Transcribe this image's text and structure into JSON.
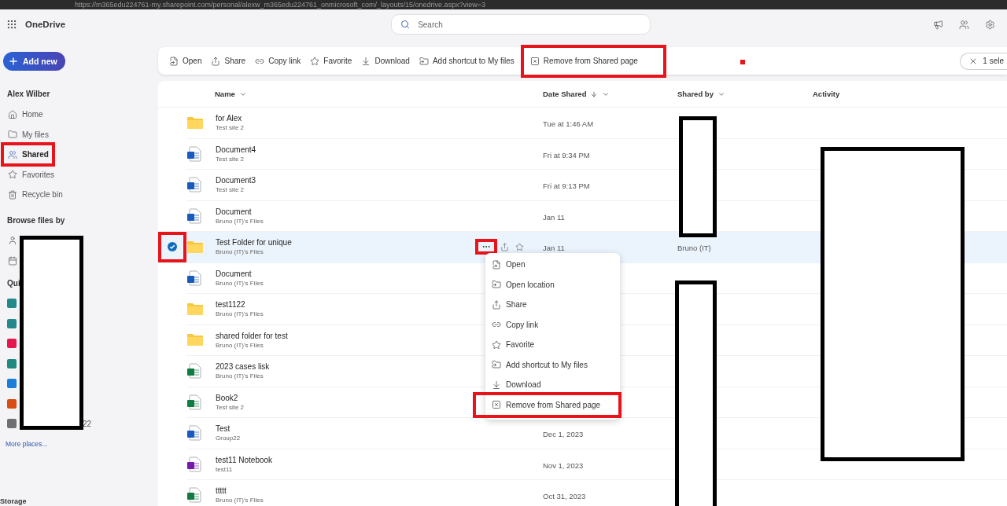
{
  "browser": {
    "address": "https://m365edu224761-my.sharepoint.com/personal/alexw_m365edu224761_onmicrosoft_com/_layouts/15/onedrive.aspx?view=3"
  },
  "app": {
    "title": "OneDrive"
  },
  "search": {
    "placeholder": "Search"
  },
  "sidebar": {
    "add_button": "Add new",
    "user": "Alex Wilber",
    "nav": [
      {
        "label": "Home",
        "kind": "home",
        "selected": false,
        "highlighted": false
      },
      {
        "label": "My files",
        "kind": "folder",
        "selected": false,
        "highlighted": false
      },
      {
        "label": "Shared",
        "kind": "people",
        "selected": true,
        "highlighted": true
      },
      {
        "label": "Favorites",
        "kind": "star",
        "selected": false,
        "highlighted": false
      },
      {
        "label": "Recycle bin",
        "kind": "bin",
        "selected": false,
        "highlighted": false
      }
    ],
    "browse_heading": "Browse files by",
    "quick_heading": "Qui",
    "quick_items": [
      {
        "color": "#23898b"
      },
      {
        "color": "#23898b"
      },
      {
        "color": "#e3194e"
      },
      {
        "color": "#1f8a80"
      },
      {
        "color": "#1a7fd9"
      },
      {
        "color": "#d94c14"
      },
      {
        "color": "#6f6f6f",
        "label": "22"
      }
    ],
    "more_places": "More places...",
    "storage": "Storage"
  },
  "toolbar": {
    "actions": [
      {
        "label": "Open",
        "kind": "open",
        "highlighted": false
      },
      {
        "label": "Share",
        "kind": "share",
        "highlighted": false
      },
      {
        "label": "Copy link",
        "kind": "link",
        "highlighted": false
      },
      {
        "label": "Favorite",
        "kind": "star",
        "highlighted": false
      },
      {
        "label": "Download",
        "kind": "download",
        "highlighted": false
      },
      {
        "label": "Add shortcut to My files",
        "kind": "shortcut",
        "highlighted": false
      },
      {
        "label": "Remove from Shared page",
        "kind": "remove",
        "highlighted": true
      }
    ],
    "selection": "1 sele"
  },
  "table": {
    "columns": [
      {
        "label": "Name",
        "sorted": false,
        "dropdown": true
      },
      {
        "label": "Date Shared",
        "sorted": true,
        "dropdown": true
      },
      {
        "label": "Shared by",
        "sorted": false,
        "dropdown": true
      },
      {
        "label": "Activity",
        "sorted": false,
        "dropdown": false
      }
    ],
    "rows": [
      {
        "name": "for Alex",
        "location": "Test site 2",
        "date": "Tue at 1:46 AM",
        "kind": "folder",
        "selected": false
      },
      {
        "name": "Document4",
        "location": "Test site 2",
        "date": "Fri at 9:34 PM",
        "kind": "word",
        "selected": false
      },
      {
        "name": "Document3",
        "location": "Test site 2",
        "date": "Fri at 9:13 PM",
        "kind": "word",
        "selected": false
      },
      {
        "name": "Document",
        "location": "Bruno (IT)'s Files",
        "date": "Jan 11",
        "kind": "word",
        "selected": false
      },
      {
        "name": "Test Folder for unique",
        "location": "Bruno (IT)'s Files",
        "date": "Jan 11",
        "shared_by": "Bruno (IT)",
        "kind": "folder",
        "selected": true,
        "highlighted": true
      },
      {
        "name": "Document",
        "location": "Bruno (IT)'s Files",
        "kind": "word",
        "selected": false
      },
      {
        "name": "test1122",
        "location": "Bruno (IT)'s Files",
        "kind": "folder",
        "selected": false
      },
      {
        "name": "shared folder for test",
        "location": "Bruno (IT)'s Files",
        "kind": "folder",
        "selected": false
      },
      {
        "name": "2023 cases lisk",
        "location": "Bruno (IT)'s Files",
        "kind": "excel",
        "selected": false
      },
      {
        "name": "Book2",
        "location": "Test site 2",
        "kind": "excel",
        "selected": false
      },
      {
        "name": "Test",
        "location": "Group22",
        "date": "Dec 1, 2023",
        "kind": "word",
        "selected": false
      },
      {
        "name": "test11 Notebook",
        "location": "test11",
        "date": "Nov 1, 2023",
        "kind": "onenote",
        "selected": false
      },
      {
        "name": "ttttt",
        "location": "Bruno (IT)'s Files",
        "date": "Oct 31, 2023",
        "kind": "excel",
        "selected": false
      }
    ]
  },
  "context_menu": {
    "button_highlighted": true,
    "items": [
      {
        "label": "Open",
        "kind": "open",
        "highlighted": false
      },
      {
        "label": "Open location",
        "kind": "shortcut",
        "highlighted": false
      },
      {
        "label": "Share",
        "kind": "share",
        "highlighted": false
      },
      {
        "label": "Copy link",
        "kind": "link",
        "highlighted": false
      },
      {
        "label": "Favorite",
        "kind": "star",
        "highlighted": false
      },
      {
        "label": "Add shortcut to My files",
        "kind": "shortcut",
        "highlighted": false
      },
      {
        "label": "Download",
        "kind": "download",
        "highlighted": false
      },
      {
        "label": "Remove from Shared page",
        "kind": "remove",
        "highlighted": true
      }
    ]
  }
}
